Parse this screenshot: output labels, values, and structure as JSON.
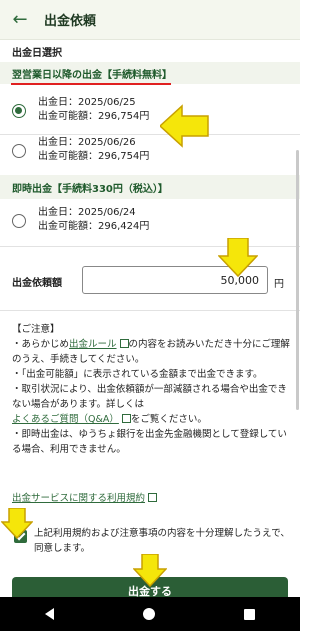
{
  "header": {
    "title": "出金依頼",
    "back_icon": "arrow-left-icon"
  },
  "section_date": {
    "label": "出金日選択"
  },
  "next_day": {
    "heading": "翌営業日以降の出金【手続料無料】",
    "options": [
      {
        "date": "出金日：2025/06/25",
        "available": "出金可能額：296,754円",
        "selected": true
      },
      {
        "date": "出金日：2025/06/26",
        "available": "出金可能額：296,754円",
        "selected": false
      }
    ]
  },
  "instant": {
    "heading": "即時出金【手続料330円（税込）】",
    "option": {
      "date": "出金日：2025/06/24",
      "available": "出金可能額：296,424円",
      "selected": false
    }
  },
  "amount": {
    "label": "出金依頼額",
    "value": "50,000",
    "unit": "円"
  },
  "notice": {
    "title": "【ご注意】",
    "line1_prefix": "・あらかじめ",
    "line1_link": "出金ルール",
    "line1_suffix": "の内容をお読みいただき十分にご理解のうえ、手続きしてください。",
    "line2": "・「出金可能額」に表示されている金額まで出金できます。",
    "line3": "・取引状況により、出金依頼額が一部減額される場合や出金できない場合があります。詳しくは",
    "line3_link": "よくあるご質問（Q&A）",
    "line3_suffix": "をご覧ください。",
    "line4": "・即時出金は、ゆうちょ銀行を出金先金融機関として登録している場合、利用できません。"
  },
  "terms_link": "出金サービスに関する利用規約",
  "agree": {
    "text": "上記利用規約および注意事項の内容を十分理解したうえで、同意します。",
    "checked": true
  },
  "submit": {
    "label": "出金する"
  },
  "colors": {
    "accent": "#2f6b3c",
    "annotation_arrow": "#f5e60a",
    "underline": "#e02020"
  }
}
